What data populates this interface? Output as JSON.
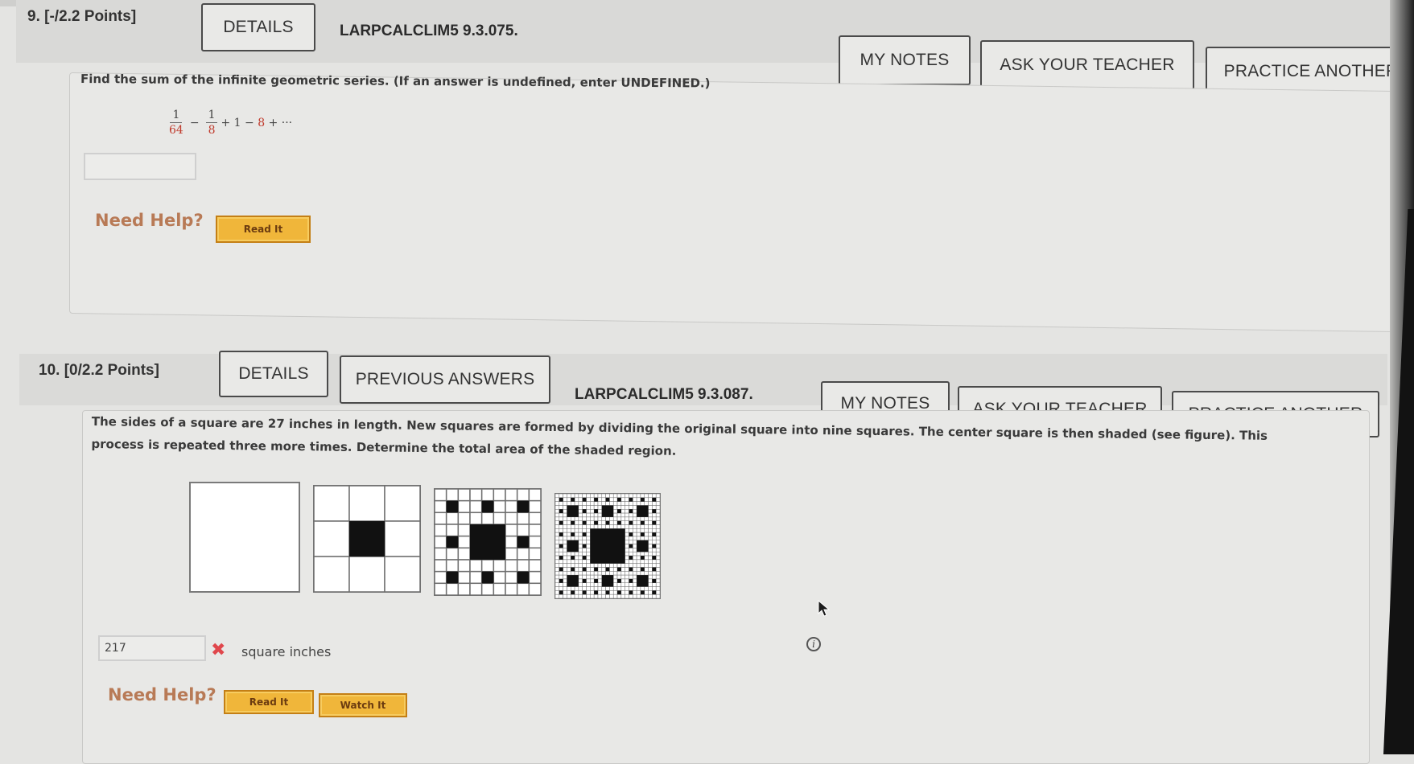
{
  "questions": [
    {
      "number": "9.",
      "points": "[-/2.2 Points]",
      "header_buttons": {
        "details": "DETAILS"
      },
      "code": "LARPCALCLIM5 9.3.075.",
      "actions": {
        "my_notes": "MY NOTES",
        "ask_teacher": "ASK YOUR TEACHER",
        "practice_another": "PRACTICE ANOTHER"
      },
      "prompt": "Find the sum of the infinite geometric series. (If an answer is undefined, enter UNDEFINED.)",
      "series": {
        "term1_num": "1",
        "term1_den": "64",
        "op1": "−",
        "term2_num": "1",
        "term2_den": "8",
        "rest": "+ 1 − ",
        "red_term": "8",
        "tail": " + ···"
      },
      "answer": {
        "value": ""
      },
      "help": {
        "label": "Need Help?",
        "read_it": "Read It"
      }
    },
    {
      "number": "10.",
      "points": "[0/2.2 Points]",
      "header_buttons": {
        "details": "DETAILS",
        "previous_answers": "PREVIOUS ANSWERS"
      },
      "code": "LARPCALCLIM5 9.3.087.",
      "actions": {
        "my_notes": "MY NOTES",
        "ask_teacher": "ASK YOUR TEACHER",
        "practice_another": "PRACTICE ANOTHER"
      },
      "prompt_line1": "The sides of a square are 27 inches in length. New squares are formed by dividing the original square into nine squares. The center square is then shaded (see figure). This",
      "prompt_line2": "process is repeated three more times. Determine the total area of the shaded region.",
      "figure": {
        "type": "sierpinski-carpet",
        "iterations": [
          0,
          1,
          2,
          3
        ]
      },
      "answer": {
        "value": "217",
        "status": "incorrect",
        "status_icon": "✖",
        "unit": "square inches"
      },
      "help": {
        "label": "Need Help?",
        "read_it": "Read It",
        "watch_it": "Watch It"
      },
      "info_icon": "i"
    }
  ]
}
